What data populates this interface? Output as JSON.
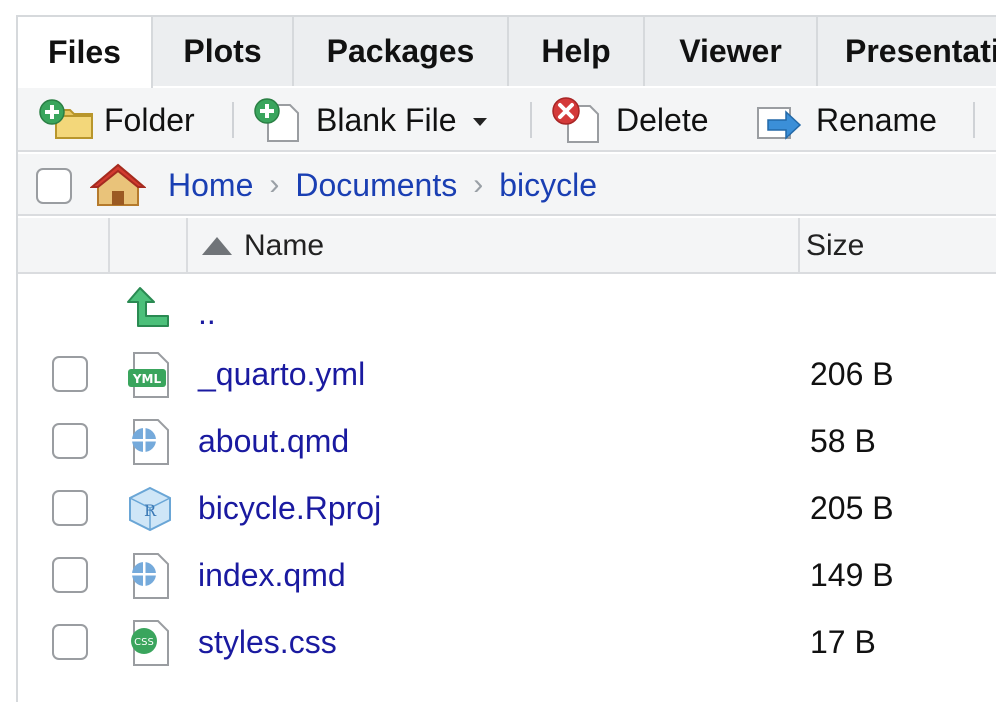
{
  "tabs": [
    {
      "label": "Files"
    },
    {
      "label": "Plots"
    },
    {
      "label": "Packages"
    },
    {
      "label": "Help"
    },
    {
      "label": "Viewer"
    },
    {
      "label": "Presentation"
    }
  ],
  "toolbar": {
    "folder_label": "Folder",
    "blank_file_label": "Blank File",
    "delete_label": "Delete",
    "rename_label": "Rename"
  },
  "breadcrumb": [
    "Home",
    "Documents",
    "bicycle"
  ],
  "columns": {
    "name": "Name",
    "size": "Size"
  },
  "parent_dir": "..",
  "files": [
    {
      "name": "_quarto.yml",
      "size": "206 B",
      "icon": "yml-file-icon"
    },
    {
      "name": "about.qmd",
      "size": "58 B",
      "icon": "quarto-file-icon"
    },
    {
      "name": "bicycle.Rproj",
      "size": "205 B",
      "icon": "rproj-file-icon"
    },
    {
      "name": "index.qmd",
      "size": "149 B",
      "icon": "quarto-file-icon"
    },
    {
      "name": "styles.css",
      "size": "17 B",
      "icon": "css-file-icon"
    }
  ],
  "colors": {
    "link": "#1a1aa0",
    "breadcrumb_link": "#1a3fb3",
    "toolbar_bg": "#f4f5f6",
    "tab_bg": "#e9ebed"
  }
}
